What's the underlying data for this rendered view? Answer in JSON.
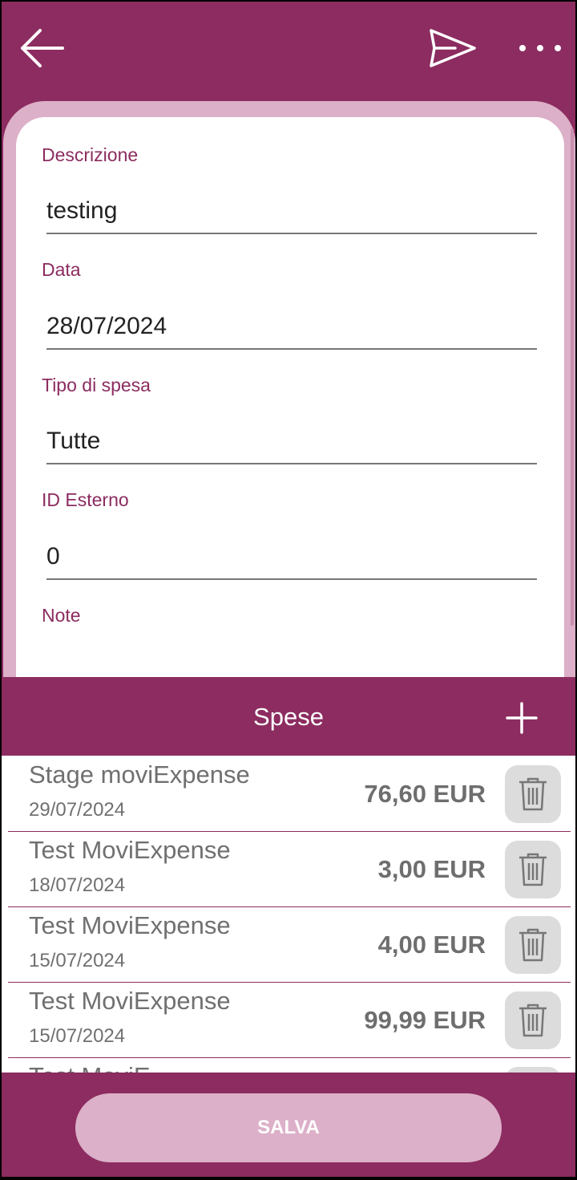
{
  "colors": {
    "primary": "#8c2c60",
    "light": "#dcb0c8"
  },
  "appbar": {
    "back_icon": "arrow-left-icon",
    "send_icon": "send-icon",
    "more_icon": "more-horizontal-icon"
  },
  "form": {
    "descrizione": {
      "label": "Descrizione",
      "value": "testing"
    },
    "data": {
      "label": "Data",
      "value": "28/07/2024"
    },
    "tipo": {
      "label": "Tipo di spesa",
      "value": "Tutte"
    },
    "id_esterno": {
      "label": "ID Esterno",
      "value": "0"
    },
    "note": {
      "label": "Note",
      "value": ""
    }
  },
  "spese": {
    "title": "Spese",
    "add_icon": "plus-icon",
    "items": [
      {
        "title": "Stage moviExpense",
        "date": "29/07/2024",
        "amount": "76,60 EUR"
      },
      {
        "title": "Test MoviExpense",
        "date": "18/07/2024",
        "amount": "3,00 EUR"
      },
      {
        "title": "Test MoviExpense",
        "date": "15/07/2024",
        "amount": "4,00 EUR"
      },
      {
        "title": "Test MoviExpense",
        "date": "15/07/2024",
        "amount": "99,99 EUR"
      },
      {
        "title": "Test MoviE",
        "date": "",
        "amount": ""
      }
    ]
  },
  "save_label": "SALVA"
}
